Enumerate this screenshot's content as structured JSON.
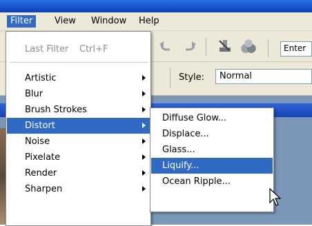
{
  "menubar": {
    "items": [
      {
        "label": "Filter",
        "active": true
      },
      {
        "label": "View"
      },
      {
        "label": "Window"
      },
      {
        "label": "Help"
      }
    ]
  },
  "toolbar": {
    "enter_field_value": "Enter",
    "style_label": "Style:",
    "style_value": "Normal",
    "icons": [
      "undo-icon",
      "redo-icon",
      "stamp-icon",
      "spheres-icon"
    ]
  },
  "filter_menu": {
    "last_filter": {
      "label": "Last Filter",
      "shortcut": "Ctrl+F",
      "disabled": true
    },
    "items": [
      {
        "label": "Artistic",
        "submenu": true
      },
      {
        "label": "Blur",
        "submenu": true
      },
      {
        "label": "Brush Strokes",
        "submenu": true
      },
      {
        "label": "Distort",
        "submenu": true,
        "selected": true
      },
      {
        "label": "Noise",
        "submenu": true
      },
      {
        "label": "Pixelate",
        "submenu": true
      },
      {
        "label": "Render",
        "submenu": true
      },
      {
        "label": "Sharpen",
        "submenu": true
      }
    ]
  },
  "distort_submenu": {
    "items": [
      {
        "label": "Diffuse Glow..."
      },
      {
        "label": "Displace..."
      },
      {
        "label": "Glass..."
      },
      {
        "label": "Liquify...",
        "selected": true
      },
      {
        "label": "Ocean Ripple..."
      }
    ]
  },
  "colors": {
    "highlight": "#316ac5",
    "menu_bg": "#ffffff",
    "chrome": "#ece9d8",
    "titlebar": "#1552cf"
  }
}
